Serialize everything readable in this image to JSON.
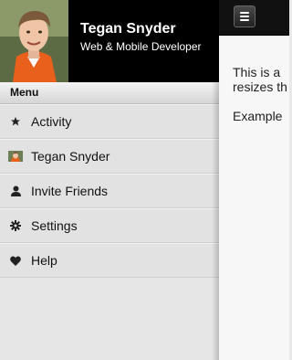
{
  "profile": {
    "name": "Tegan Snyder",
    "role": "Web & Mobile Developer"
  },
  "menu": {
    "header": "Menu",
    "items": [
      {
        "label": "Activity",
        "icon": "star-icon"
      },
      {
        "label": "Tegan Snyder",
        "icon": "user-thumbnail-icon"
      },
      {
        "label": "Invite Friends",
        "icon": "person-icon"
      },
      {
        "label": "Settings",
        "icon": "gear-icon"
      },
      {
        "label": "Help",
        "icon": "heart-icon"
      }
    ]
  },
  "main": {
    "paragraph1": "This is a",
    "paragraph1_line2": "resizes th",
    "paragraph2": "Example"
  }
}
